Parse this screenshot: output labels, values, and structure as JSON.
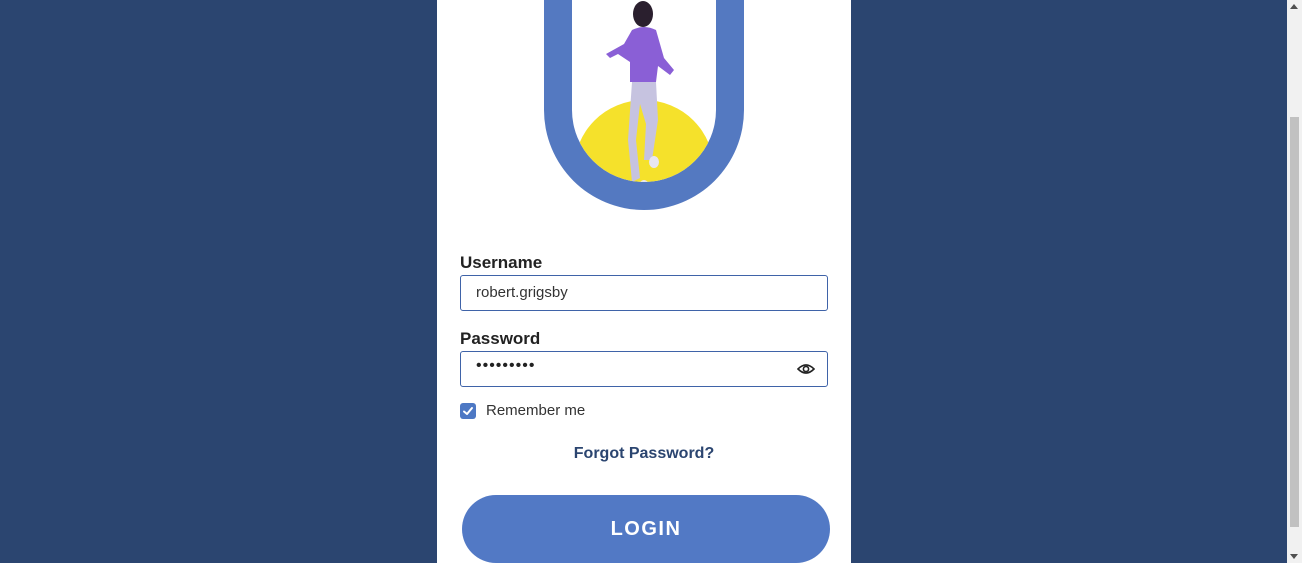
{
  "form": {
    "username_label": "Username",
    "username_value": "robert.grigsby",
    "password_label": "Password",
    "password_masked": "•••••••••",
    "remember_label": "Remember me",
    "remember_checked": true,
    "forgot_link": "Forgot Password?",
    "login_button": "LOGIN"
  },
  "icons": {
    "password_toggle": "eye-icon",
    "checkbox_mark": "checkmark-icon",
    "scroll_up": "scroll-up-arrow-icon",
    "scroll_down": "scroll-down-arrow-icon"
  },
  "colors": {
    "background": "#2b4570",
    "card": "#ffffff",
    "accent": "#5279c5",
    "hero_arch": "#5479c1",
    "hero_sun": "#f5e12b",
    "link": "#2b4570"
  }
}
